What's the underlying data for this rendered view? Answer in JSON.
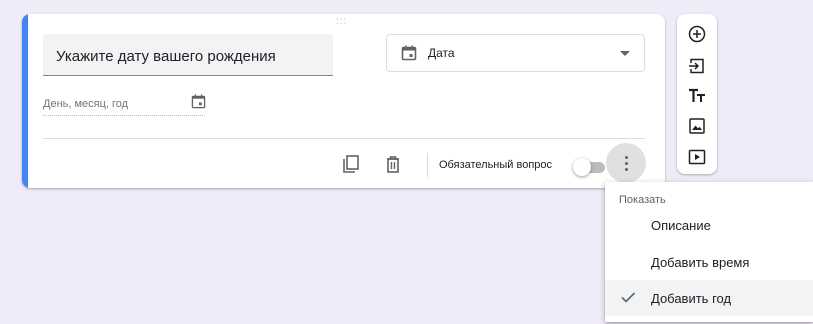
{
  "question": {
    "title": "Укажите дату вашего рождения",
    "type_label": "Дата",
    "date_placeholder": "День, месяц, год",
    "required_label": "Обязательный вопрос",
    "drag_handle": ":::"
  },
  "menu": {
    "header": "Показать",
    "items": [
      {
        "label": "Описание",
        "checked": false
      },
      {
        "label": "Добавить время",
        "checked": false
      },
      {
        "label": "Добавить год",
        "checked": true
      }
    ]
  },
  "toolbar": {
    "tools": [
      "add-question-icon",
      "import-questions-icon",
      "add-title-icon",
      "add-image-icon",
      "add-video-icon"
    ]
  },
  "colors": {
    "accent": "#4285f4",
    "background": "#f0ebf8",
    "icon": "#5f6368"
  }
}
